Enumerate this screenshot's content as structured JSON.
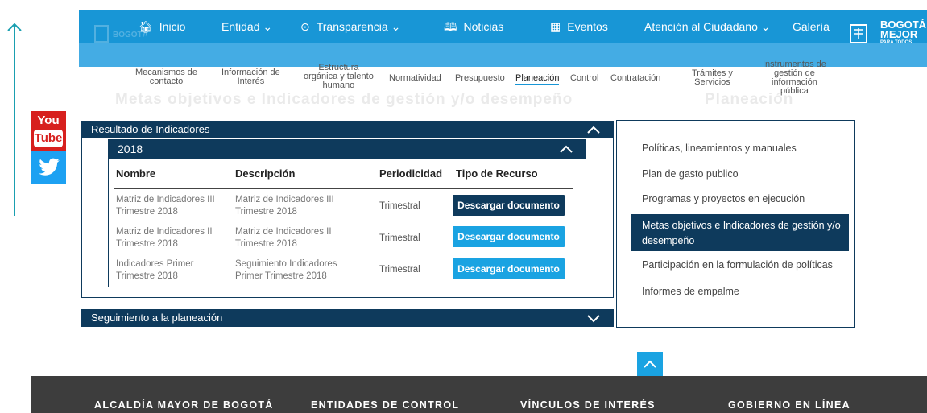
{
  "nav": {
    "items": [
      {
        "label": "Inicio",
        "icon": "home-icon"
      },
      {
        "label": "Entidad ⌄",
        "icon": ""
      },
      {
        "label": "Transparencia ⌄",
        "icon": "check-circle-icon"
      },
      {
        "label": "Noticias",
        "icon": "book-icon"
      },
      {
        "label": "Eventos",
        "icon": "calendar-icon"
      },
      {
        "label": "Atención al Ciudadano ⌄",
        "icon": ""
      },
      {
        "label": "Galería",
        "icon": ""
      }
    ],
    "logo_top": "BOGOTÁ",
    "logo_bottom": "MEJOR",
    "logo_tag": "PARA TODOS",
    "color": "#1896d6"
  },
  "subnav": [
    {
      "l1": "Mecanismos de",
      "l2": "contacto",
      "l3": ""
    },
    {
      "l1": "Información de",
      "l2": "Interés",
      "l3": ""
    },
    {
      "l1": "Estructura",
      "l2": "orgánica y talento",
      "l3": "humano"
    },
    {
      "l1": "Normatividad",
      "l2": "",
      "l3": ""
    },
    {
      "l1": "Presupuesto",
      "l2": "",
      "l3": ""
    },
    {
      "l1": "Planeación",
      "l2": "",
      "l3": ""
    },
    {
      "l1": "Control",
      "l2": "",
      "l3": ""
    },
    {
      "l1": "Contratación",
      "l2": "",
      "l3": ""
    },
    {
      "l1": "Trámites y",
      "l2": "Servicios",
      "l3": ""
    },
    {
      "l1": "Instrumentos de",
      "l2": "gestión de",
      "l3": "información",
      "l4": "pública"
    }
  ],
  "ghost": {
    "title": "Metas objetivos e Indicadores de gestión y/o desempeño",
    "section": "Planeación"
  },
  "accordion": {
    "main_title": "Resultado de Indicadores",
    "year": "2018",
    "second_title": "Seguimiento a la planeación"
  },
  "table": {
    "headers": [
      "Nombre",
      "Descripción",
      "Periodicidad",
      "Tipo de Recurso"
    ],
    "rows": [
      {
        "nombre1": "Matriz de Indicadores III",
        "nombre2": "Trimestre 2018",
        "desc1": "Matriz de Indicadores III",
        "desc2": "Trimestre 2018",
        "periodicidad": "Trimestral",
        "button": "Descargar documento"
      },
      {
        "nombre1": "Matriz de Indicadores II",
        "nombre2": "Trimestre 2018",
        "desc1": "Matriz de Indicadores II",
        "desc2": "Trimestre 2018",
        "periodicidad": "Trimestral",
        "button": "Descargar documento"
      },
      {
        "nombre1": "Indicadores Primer",
        "nombre2": "Trimestre 2018",
        "desc1": "Seguimiento Indicadores",
        "desc2": "Primer Trimestre 2018",
        "periodicidad": "Trimestral",
        "button": "Descargar documento"
      }
    ]
  },
  "side_menu": {
    "items": [
      "Políticas, lineamientos y manuales",
      "Plan de gasto publico",
      "Programas y proyectos en ejecución",
      "Participación en la formulación de políticas",
      "Informes de empalme"
    ],
    "active": "Metas objetivos e Indicadores de gestión y/o desempeño"
  },
  "social": {
    "youtube_l1": "You",
    "youtube_l2": "Tube"
  },
  "footer": {
    "items": [
      "ALCALDÍA MAYOR DE BOGOTÁ",
      "ENTIDADES DE CONTROL",
      "VÍNCULOS DE INTERÉS",
      "GOBIERNO EN LÍNEA"
    ]
  }
}
